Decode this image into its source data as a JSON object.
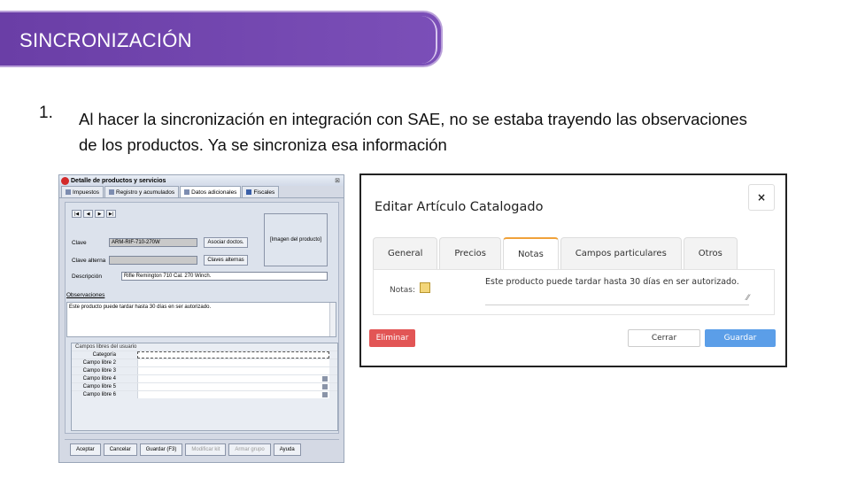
{
  "slide": {
    "title": "SINCRONIZACIÓN",
    "point_number": "1.",
    "point_text": "Al hacer la sincronización en integración con SAE, no se estaba trayendo las observaciones de los productos. Ya se sincroniza esa información"
  },
  "left_window": {
    "title": "Detalle de productos y servicios",
    "close": "⊠",
    "tabs": [
      "Impuestos",
      "Registro y acumulados",
      "Datos adicionales",
      "Fiscales"
    ],
    "nav_buttons": [
      "|◀",
      "◀",
      "▶",
      "▶|"
    ],
    "clave_label": "Clave",
    "clave_value": "ARM-RIF-710-270W",
    "asociar_button": "Asociar doctos.",
    "clave_alterna_label": "Clave alterna",
    "claves_alternas_button": "Claves alternas",
    "imagen_label": "[Imagen del producto]",
    "descripcion_label": "Descripción",
    "descripcion_value": "Rifle Remington 710 Cal. 270 Winch.",
    "observaciones_label": "Observaciones",
    "observaciones_value": "Este producto puede tardar hasta 30 días en ser autorizado.",
    "campos_title": "Campos libres del usuario",
    "campos_rows": [
      "Categoría",
      "Campo libre 2",
      "Campo libre 3",
      "Campo libre 4",
      "Campo libre 5",
      "Campo libre 6"
    ],
    "footer_buttons": [
      "Aceptar",
      "Cancelar",
      "Guardar (F3)",
      "Modificar kit",
      "Armar grupo",
      "Ayuda"
    ]
  },
  "dialog": {
    "title": "Editar Artículo Catalogado",
    "close": "×",
    "tabs": [
      "General",
      "Precios",
      "Notas",
      "Campos particulares",
      "Otros"
    ],
    "active_tab": "Notas",
    "notas_label": "Notas:",
    "notas_value": "Este producto puede tardar hasta 30 días en ser autorizado.",
    "delete_button": "Eliminar",
    "close_button": "Cerrar",
    "save_button": "Guardar"
  }
}
